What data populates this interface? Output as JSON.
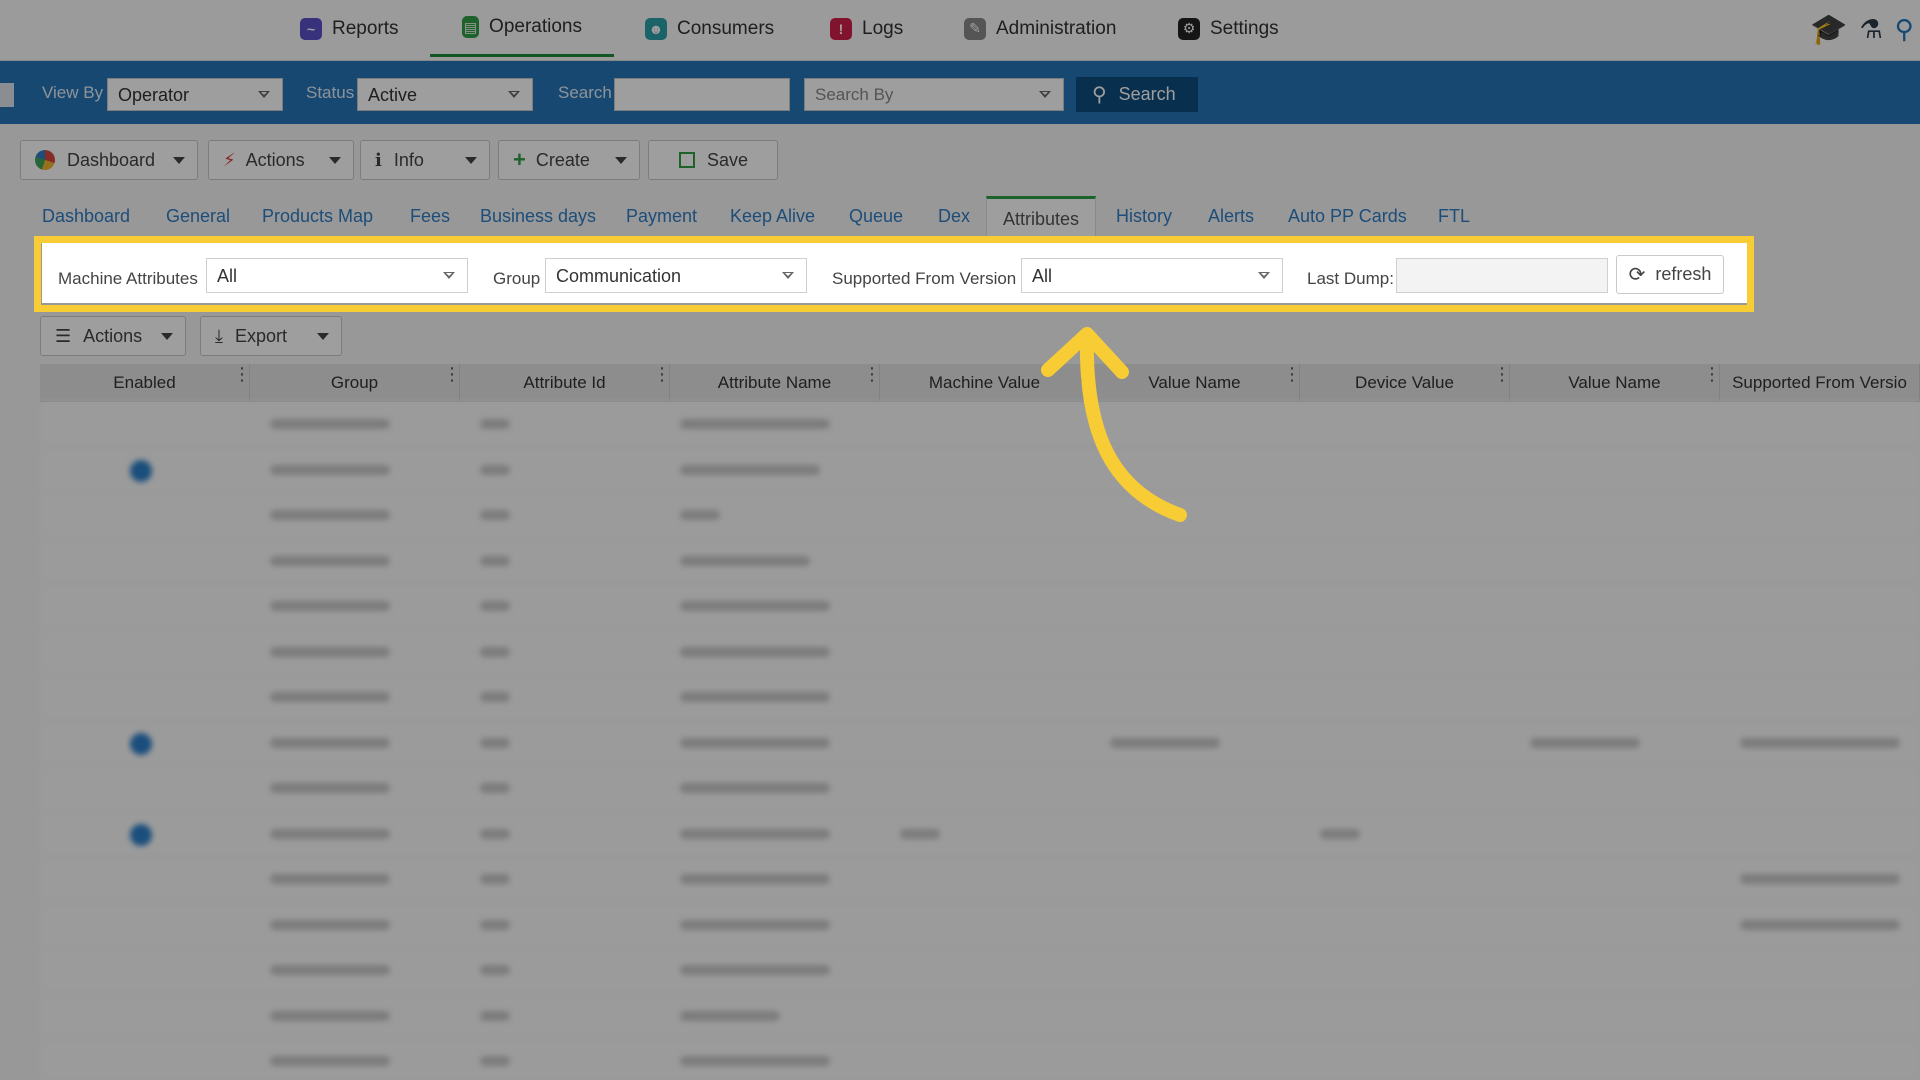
{
  "top_nav": {
    "items": [
      {
        "label": "Reports",
        "icon": "chart-icon",
        "color": "#5b4fc9"
      },
      {
        "label": "Operations",
        "icon": "operations-icon",
        "color": "#2f9e44"
      },
      {
        "label": "Consumers",
        "icon": "consumers-icon",
        "color": "#2aa0a8"
      },
      {
        "label": "Logs",
        "icon": "logs-icon",
        "color": "#d21f4c"
      },
      {
        "label": "Administration",
        "icon": "admin-icon",
        "color": "#8a8a8a"
      },
      {
        "label": "Settings",
        "icon": "gear-icon",
        "color": "#222222"
      }
    ],
    "active": "Operations"
  },
  "filter_bar": {
    "view_by_label": "View By",
    "view_by_value": "Operator",
    "status_label": "Status",
    "status_value": "Active",
    "search_label": "Search",
    "search_value": "",
    "search_by_placeholder": "Search By",
    "search_button": "Search",
    "bar_color": "#2474b8"
  },
  "toolbar": {
    "dashboard": "Dashboard",
    "actions": "Actions",
    "info": "Info",
    "create": "Create",
    "save": "Save"
  },
  "tabs": [
    "Dashboard",
    "General",
    "Products Map",
    "Fees",
    "Business days",
    "Payment",
    "Keep Alive",
    "Queue",
    "Dex",
    "Attributes",
    "History",
    "Alerts",
    "Auto PP Cards",
    "FTL"
  ],
  "active_tab": "Attributes",
  "attributes_panel": {
    "machine_attributes_label": "Machine Attributes",
    "machine_attributes_value": "All",
    "group_label": "Group",
    "group_value": "Communication",
    "supported_from_version_label": "Supported From Version",
    "supported_from_version_value": "All",
    "last_dump_label": "Last Dump:",
    "last_dump_value": "",
    "refresh_button": "refresh"
  },
  "grid_toolbar": {
    "actions": "Actions",
    "export": "Export"
  },
  "grid": {
    "columns": [
      "Enabled",
      "Group",
      "Attribute Id",
      "Attribute Name",
      "Machine Value",
      "Value Name",
      "Device Value",
      "Value Name",
      "Supported From Versio"
    ]
  },
  "highlight_color": "#f7cc35"
}
